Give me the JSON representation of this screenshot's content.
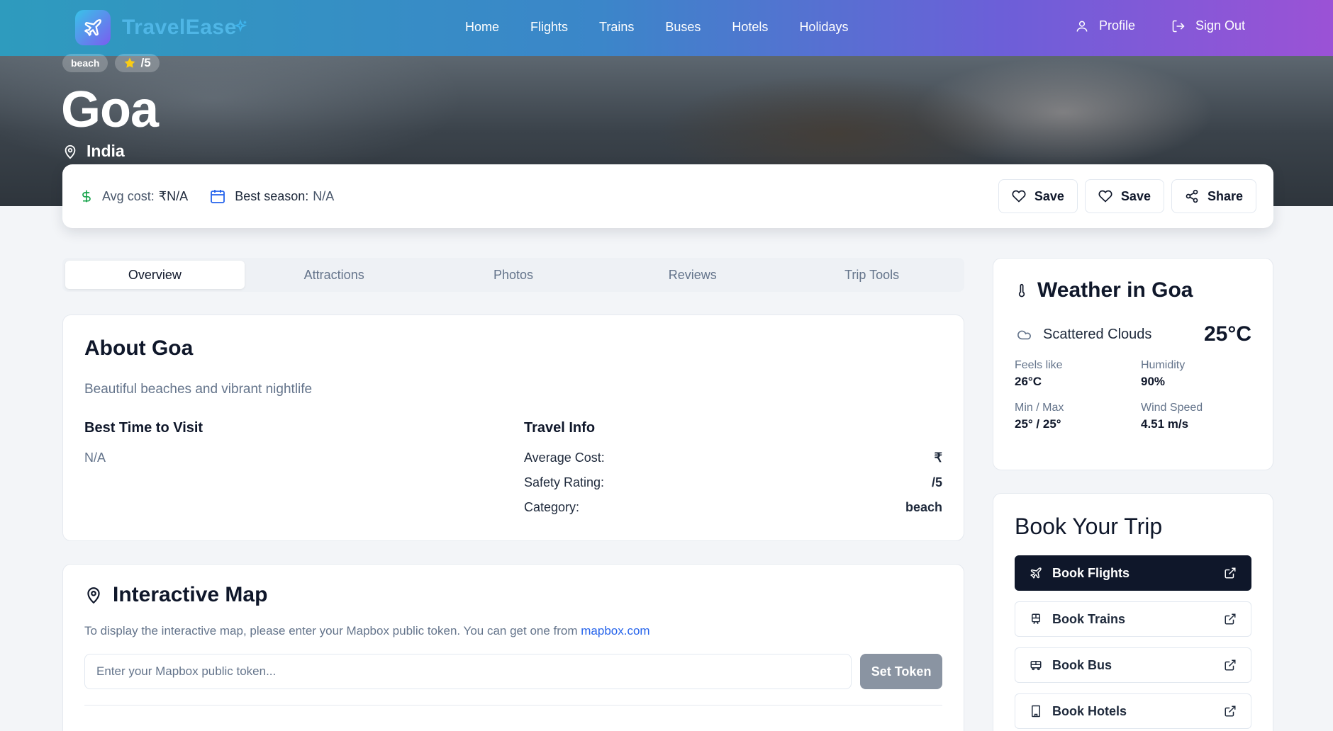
{
  "header": {
    "brand": "TravelEase",
    "nav": [
      "Home",
      "Flights",
      "Trains",
      "Buses",
      "Hotels",
      "Holidays"
    ],
    "profile": "Profile",
    "sign_out": "Sign Out"
  },
  "hero": {
    "tag_category": "beach",
    "tag_rating": "/5",
    "title": "Goa",
    "location": "India"
  },
  "infobar": {
    "avg_cost_label": "Avg cost:",
    "avg_cost_value": "₹N/A",
    "best_season_label": "Best season:",
    "best_season_value": "N/A",
    "save1": "Save",
    "save2": "Save",
    "share": "Share"
  },
  "tabs": [
    "Overview",
    "Attractions",
    "Photos",
    "Reviews",
    "Trip Tools"
  ],
  "about": {
    "title": "About Goa",
    "description": "Beautiful beaches and vibrant nightlife",
    "best_time_heading": "Best Time to Visit",
    "best_time_value": "N/A",
    "travel_info_heading": "Travel Info",
    "rows": [
      {
        "label": "Average Cost:",
        "value": "₹"
      },
      {
        "label": "Safety Rating:",
        "value": "/5"
      },
      {
        "label": "Category:",
        "value": "beach"
      }
    ]
  },
  "map": {
    "title": "Interactive Map",
    "note": "To display the interactive map, please enter your Mapbox public token. You can get one from ",
    "link": "mapbox.com",
    "placeholder": "Enter your Mapbox public token...",
    "button": "Set Token"
  },
  "weather": {
    "title": "Weather in Goa",
    "condition": "Scattered Clouds",
    "temp": "25°C",
    "feels_like_label": "Feels like",
    "feels_like": "26°C",
    "humidity_label": "Humidity",
    "humidity": "90%",
    "minmax_label": "Min / Max",
    "minmax": "25° / 25°",
    "wind_label": "Wind Speed",
    "wind": "4.51 m/s"
  },
  "book": {
    "title": "Book Your Trip",
    "flights": "Book Flights",
    "trains": "Book Trains",
    "bus": "Book Bus",
    "hotels": "Book Hotels"
  },
  "colors": {
    "header_start": "#2e9bbe",
    "header_end": "#9b52d6",
    "dark_button": "#0f172a",
    "cost_icon": "#16a34a",
    "calendar_icon": "#2563eb",
    "link": "#2563eb"
  }
}
